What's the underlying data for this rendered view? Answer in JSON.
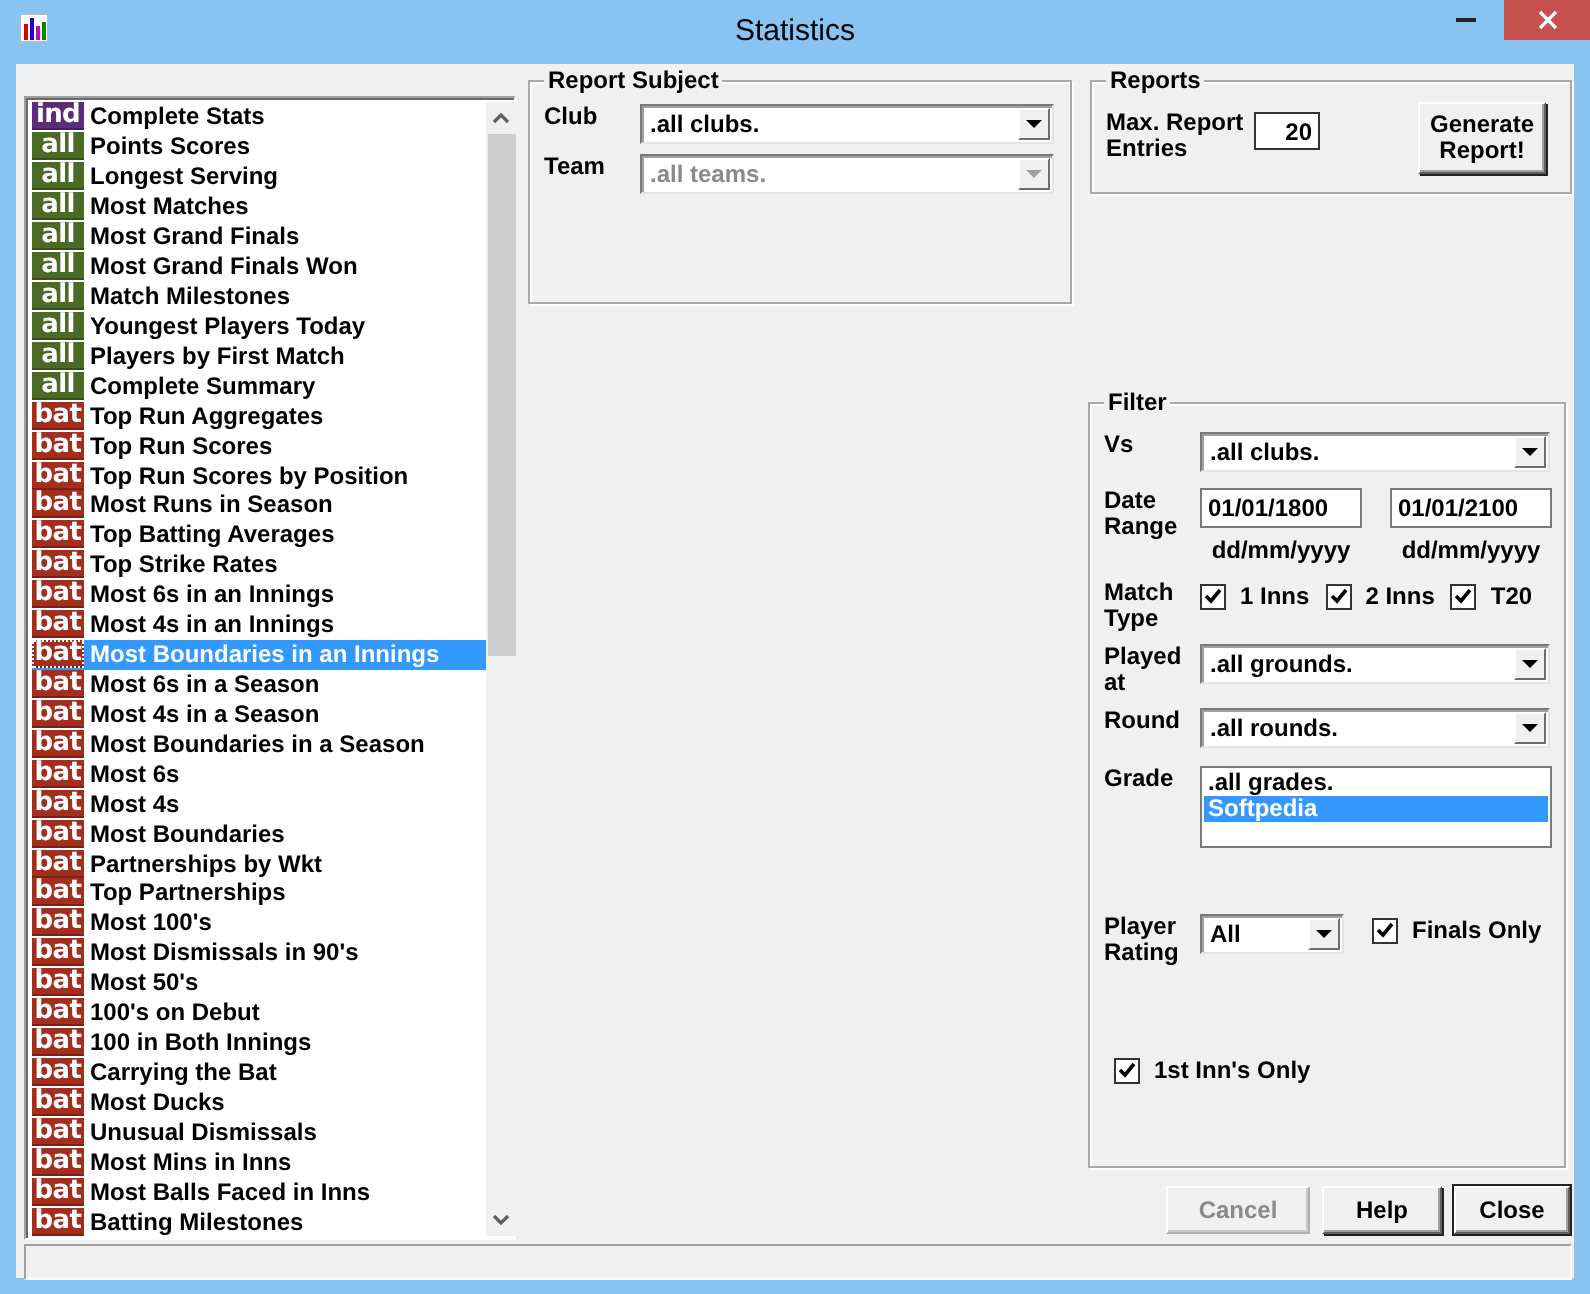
{
  "window": {
    "title": "Statistics"
  },
  "report_list": {
    "items": [
      {
        "badge": "ind",
        "color": "#5b2c78",
        "label": "Complete Stats",
        "selected": false
      },
      {
        "badge": "all",
        "color": "#4b6a26",
        "label": "Points Scores",
        "selected": false
      },
      {
        "badge": "all",
        "color": "#4b6a26",
        "label": "Longest Serving",
        "selected": false
      },
      {
        "badge": "all",
        "color": "#4b6a26",
        "label": "Most Matches",
        "selected": false
      },
      {
        "badge": "all",
        "color": "#4b6a26",
        "label": "Most Grand Finals",
        "selected": false
      },
      {
        "badge": "all",
        "color": "#4b6a26",
        "label": "Most Grand Finals Won",
        "selected": false
      },
      {
        "badge": "all",
        "color": "#4b6a26",
        "label": "Match Milestones",
        "selected": false
      },
      {
        "badge": "all",
        "color": "#4b6a26",
        "label": "Youngest Players Today",
        "selected": false
      },
      {
        "badge": "all",
        "color": "#4b6a26",
        "label": "Players by First Match",
        "selected": false
      },
      {
        "badge": "all",
        "color": "#4b6a26",
        "label": "Complete Summary",
        "selected": false
      },
      {
        "badge": "bat",
        "color": "#a32e1e",
        "label": "Top Run Aggregates",
        "selected": false
      },
      {
        "badge": "bat",
        "color": "#a32e1e",
        "label": "Top Run Scores",
        "selected": false
      },
      {
        "badge": "bat",
        "color": "#a32e1e",
        "label": "Top Run Scores by Position",
        "selected": false
      },
      {
        "badge": "bat",
        "color": "#a32e1e",
        "label": "Most Runs in Season",
        "selected": false
      },
      {
        "badge": "bat",
        "color": "#a32e1e",
        "label": "Top Batting Averages",
        "selected": false
      },
      {
        "badge": "bat",
        "color": "#a32e1e",
        "label": "Top Strike Rates",
        "selected": false
      },
      {
        "badge": "bat",
        "color": "#a32e1e",
        "label": "Most 6s in an Innings",
        "selected": false
      },
      {
        "badge": "bat",
        "color": "#a32e1e",
        "label": "Most 4s in an Innings",
        "selected": false
      },
      {
        "badge": "bat",
        "color": "#a32e1e",
        "label": "Most Boundaries in an Innings",
        "selected": true
      },
      {
        "badge": "bat",
        "color": "#a32e1e",
        "label": "Most 6s in a Season",
        "selected": false
      },
      {
        "badge": "bat",
        "color": "#a32e1e",
        "label": "Most 4s in a Season",
        "selected": false
      },
      {
        "badge": "bat",
        "color": "#a32e1e",
        "label": "Most Boundaries in a Season",
        "selected": false
      },
      {
        "badge": "bat",
        "color": "#a32e1e",
        "label": "Most 6s",
        "selected": false
      },
      {
        "badge": "bat",
        "color": "#a32e1e",
        "label": "Most 4s",
        "selected": false
      },
      {
        "badge": "bat",
        "color": "#a32e1e",
        "label": "Most Boundaries",
        "selected": false
      },
      {
        "badge": "bat",
        "color": "#a32e1e",
        "label": "Partnerships by Wkt",
        "selected": false
      },
      {
        "badge": "bat",
        "color": "#a32e1e",
        "label": "Top Partnerships",
        "selected": false
      },
      {
        "badge": "bat",
        "color": "#a32e1e",
        "label": "Most 100's",
        "selected": false
      },
      {
        "badge": "bat",
        "color": "#a32e1e",
        "label": "Most Dismissals in 90's",
        "selected": false
      },
      {
        "badge": "bat",
        "color": "#a32e1e",
        "label": "Most 50's",
        "selected": false
      },
      {
        "badge": "bat",
        "color": "#a32e1e",
        "label": "100's on Debut",
        "selected": false
      },
      {
        "badge": "bat",
        "color": "#a32e1e",
        "label": "100 in Both Innings",
        "selected": false
      },
      {
        "badge": "bat",
        "color": "#a32e1e",
        "label": "Carrying the Bat",
        "selected": false
      },
      {
        "badge": "bat",
        "color": "#a32e1e",
        "label": "Most Ducks",
        "selected": false
      },
      {
        "badge": "bat",
        "color": "#a32e1e",
        "label": "Unusual Dismissals",
        "selected": false
      },
      {
        "badge": "bat",
        "color": "#a32e1e",
        "label": "Most Mins in Inns",
        "selected": false
      },
      {
        "badge": "bat",
        "color": "#a32e1e",
        "label": "Most Balls Faced in Inns",
        "selected": false
      },
      {
        "badge": "bat",
        "color": "#a32e1e",
        "label": "Batting Milestones",
        "selected": false
      }
    ]
  },
  "report_subject": {
    "title": "Report Subject",
    "club": {
      "label": "Club",
      "value": ".all clubs.",
      "disabled": false
    },
    "team": {
      "label": "Team",
      "value": ".all teams.",
      "disabled": true
    }
  },
  "reports": {
    "title": "Reports",
    "max_entries_label": "Max. Report Entries",
    "max_entries": "20",
    "generate_button": "Generate Report!"
  },
  "filter": {
    "title": "Filter",
    "vs": {
      "label": "Vs",
      "value": ".all clubs."
    },
    "date_range": {
      "label": "Date Range",
      "from": "01/01/1800",
      "to": "01/01/2100",
      "from_format": "dd/mm/yyyy",
      "to_format": "dd/mm/yyyy"
    },
    "match_type": {
      "label": "Match Type",
      "options": [
        {
          "label": "1 Inns",
          "checked": true
        },
        {
          "label": "2 Inns",
          "checked": true
        },
        {
          "label": "T20",
          "checked": true
        }
      ]
    },
    "played_at": {
      "label": "Played at",
      "value": ".all grounds."
    },
    "round": {
      "label": "Round",
      "value": ".all rounds."
    },
    "grade": {
      "label": "Grade",
      "options": [
        {
          "label": ".all grades.",
          "selected": false
        },
        {
          "label": "Softpedia",
          "selected": true
        }
      ]
    },
    "player_rating": {
      "label": "Player Rating",
      "value": "All"
    },
    "finals_only": {
      "label": "Finals Only",
      "checked": true
    },
    "first_inns_only": {
      "label": "1st Inn's Only",
      "checked": true
    }
  },
  "buttons": [
    {
      "label": "Cancel",
      "disabled": true,
      "default": false
    },
    {
      "label": "Help",
      "disabled": false,
      "default": false
    },
    {
      "label": "Close",
      "disabled": false,
      "default": true
    }
  ]
}
